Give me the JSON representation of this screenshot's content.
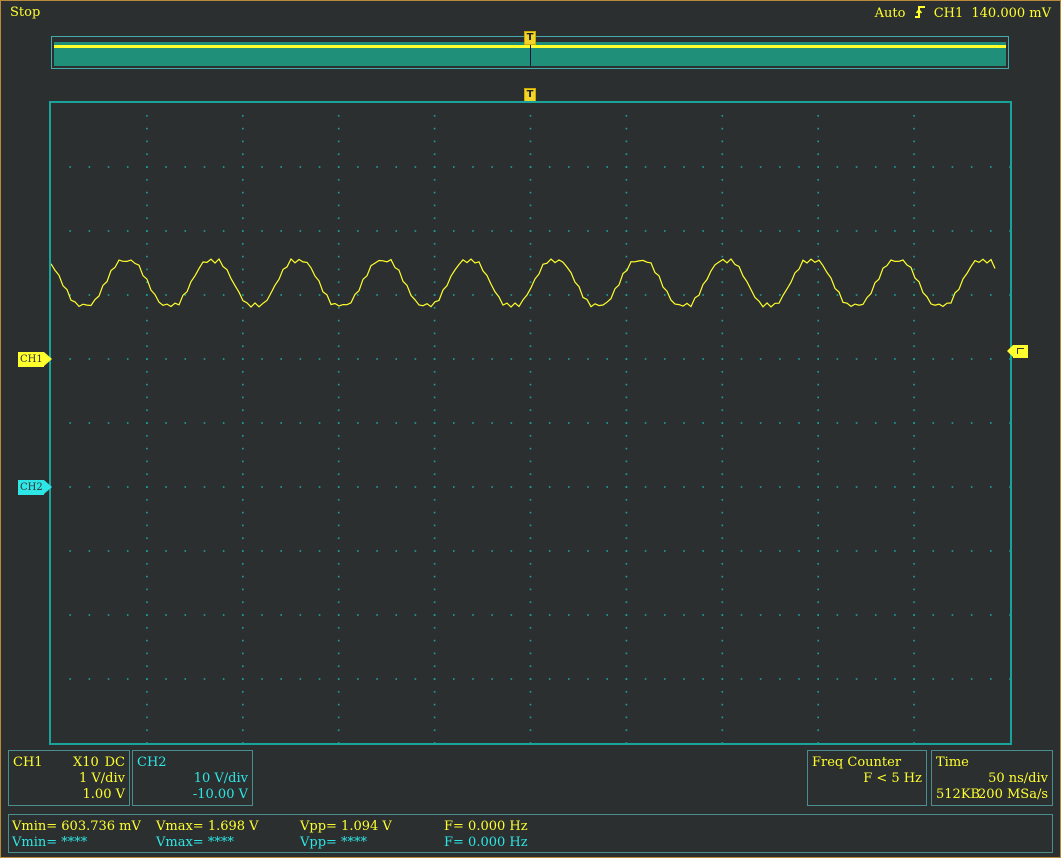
{
  "status": "Stop",
  "trigger": {
    "mode": "Auto",
    "edge_icon": "rising-edge-icon",
    "source": "CH1",
    "level": "140.000 mV"
  },
  "markers": {
    "trigger": "T",
    "ch1": "CH1",
    "ch2": "CH2"
  },
  "colors": {
    "ch1": "#ffff2e",
    "ch2": "#2ee6e6",
    "grid": "#1aa39a",
    "background": "#2b2f2f"
  },
  "waveform": {
    "channel": "CH1",
    "display_grid_divisions": {
      "horizontal": 10,
      "vertical": 10
    }
  },
  "ch1_panel": {
    "label": "CH1",
    "probe": "X10",
    "coupling": "DC",
    "scale": "1 V/div",
    "offset": "1.00 V"
  },
  "ch2_panel": {
    "label": "CH2",
    "scale": "10 V/div",
    "offset": "-10.00 V"
  },
  "freq_panel": {
    "label": "Freq Counter",
    "value": "F < 5 Hz"
  },
  "time_panel": {
    "label": "Time",
    "scale": "50 ns/div",
    "memory": "512KB",
    "rate": "200 MSa/s"
  },
  "measurements": {
    "ch1": {
      "vmin": "Vmin= 603.736 mV",
      "vmax": "Vmax= 1.698 V",
      "vpp": "Vpp= 1.094 V",
      "freq": "F= 0.000 Hz"
    },
    "ch2": {
      "vmin": "Vmin= ****",
      "vmax": "Vmax= ****",
      "vpp": "Vpp= ****",
      "freq": "F= 0.000 Hz"
    }
  }
}
